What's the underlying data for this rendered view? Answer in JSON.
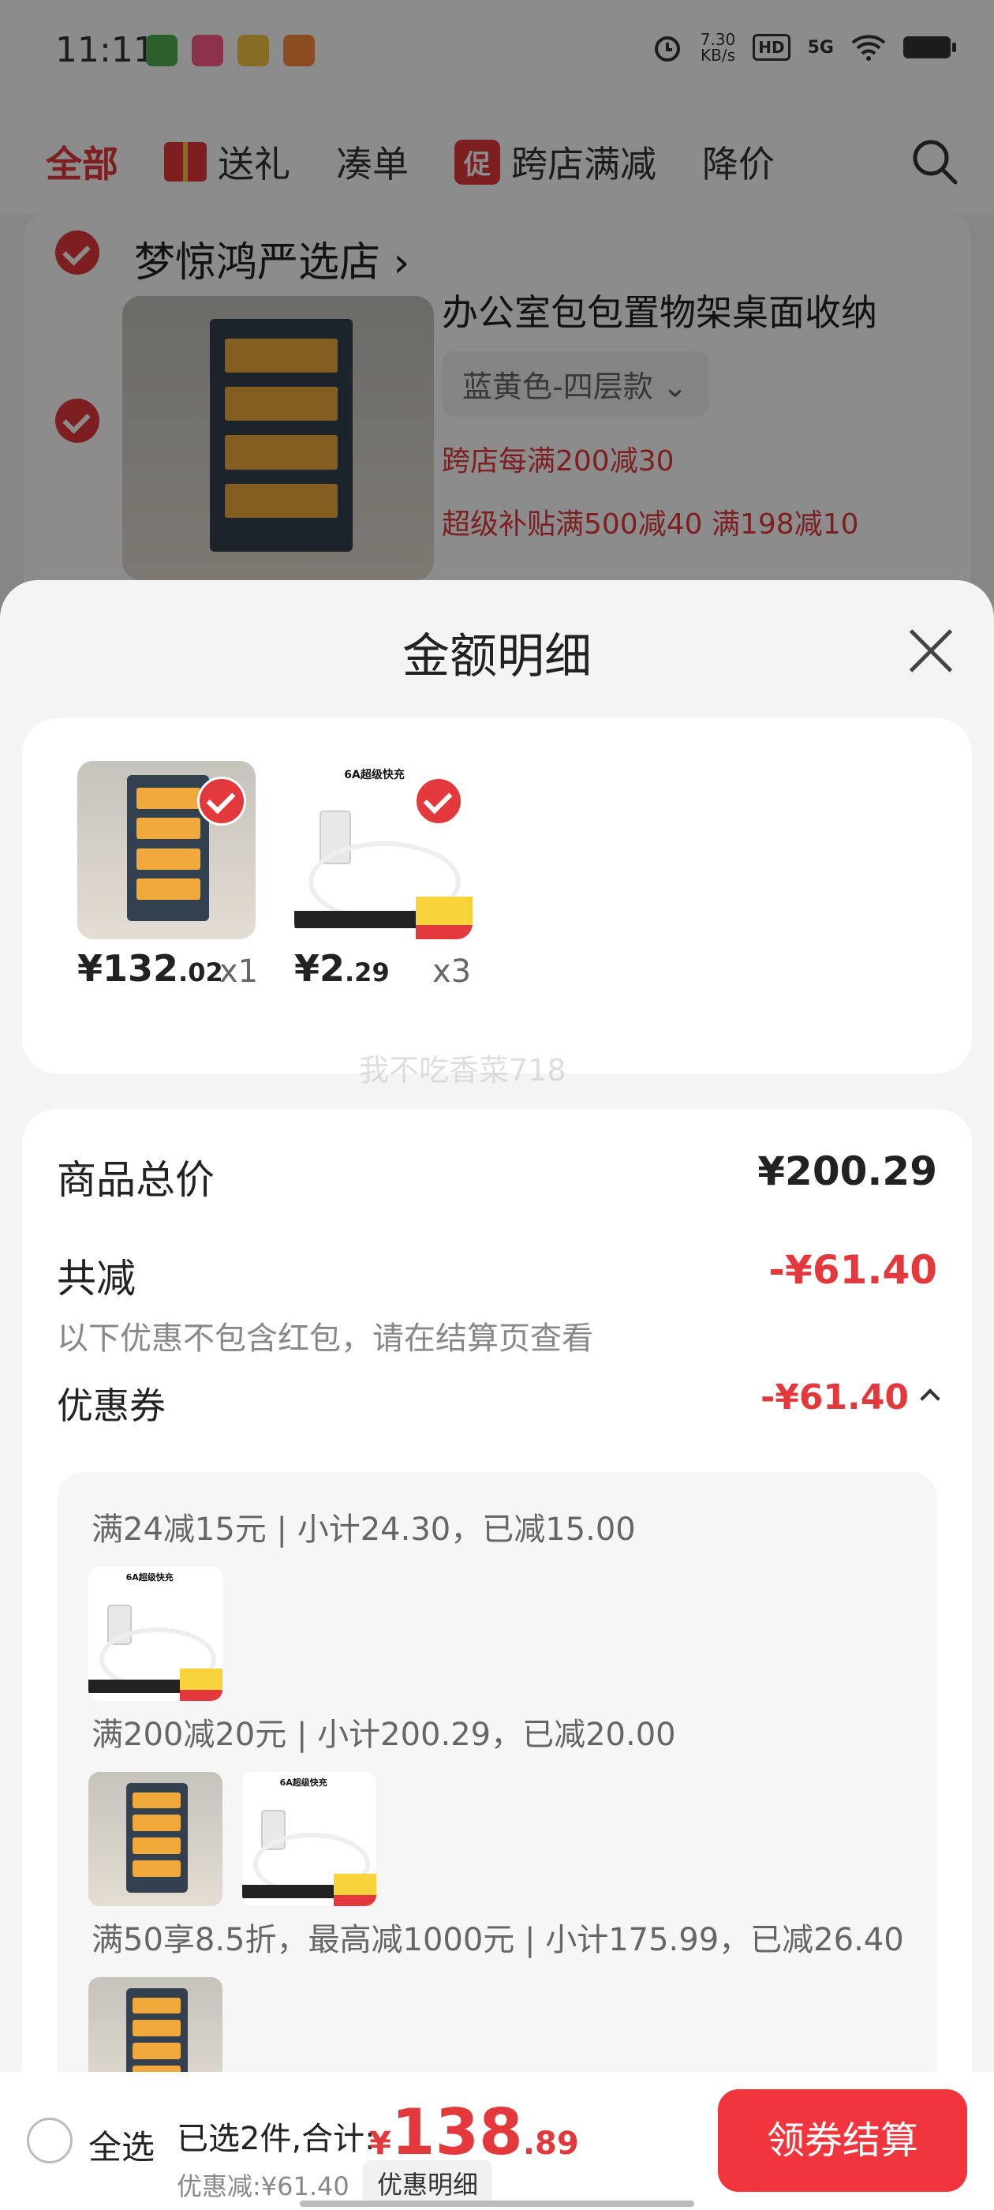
{
  "status_bar": {
    "time": "11:11",
    "net_speed_value": "7.30",
    "net_speed_unit": "KB/s",
    "hd": "HD",
    "signal": "5G"
  },
  "tabs": [
    {
      "label": "全部"
    },
    {
      "label": "送礼"
    },
    {
      "label": "凑单"
    },
    {
      "label": "跨店满减",
      "badge": "促"
    },
    {
      "label": "降价"
    }
  ],
  "shop": {
    "name": "梦惊鸿严选店",
    "product_title": "办公室包包置物架桌面收纳",
    "variant": "蓝黄色-四层款",
    "promo_1": "跨店每满200减30",
    "promo_2": "超级补贴满500减40  满198减10"
  },
  "sheet": {
    "title": "金额明细",
    "products": [
      {
        "price_int": "¥132",
        "price_dec": ".02",
        "qty": "x1"
      },
      {
        "price_int": "¥2",
        "price_dec": ".29",
        "qty": "x3"
      }
    ],
    "watermark": "我不吃香菜718",
    "total_label": "商品总价",
    "total_value": "¥200.29",
    "reduce_label": "共减",
    "reduce_value": "-¥61.40",
    "reduce_note": "以下优惠不包含红包，请在结算页查看",
    "coupon_label": "优惠券",
    "coupon_value": "-¥61.40",
    "coupon_lines": [
      "满24减15元 | 小计24.30，已减15.00",
      "满200减20元 | 小计200.29，已减20.00",
      "满50享8.5折，最高减1000元 | 小计175.99，已减26.40"
    ],
    "cable_text": "6A超级快充"
  },
  "bottom_bar": {
    "select_all": "全选",
    "selected_count": "已选2件,合计:",
    "total_yen": "¥",
    "total_int": "138",
    "total_dec": ".89",
    "discount": "优惠减:¥61.40",
    "detail_button": "优惠明细",
    "checkout_button": "领券结算"
  },
  "colors": {
    "accent": "#e4393c",
    "checkout": "#f0363c"
  }
}
